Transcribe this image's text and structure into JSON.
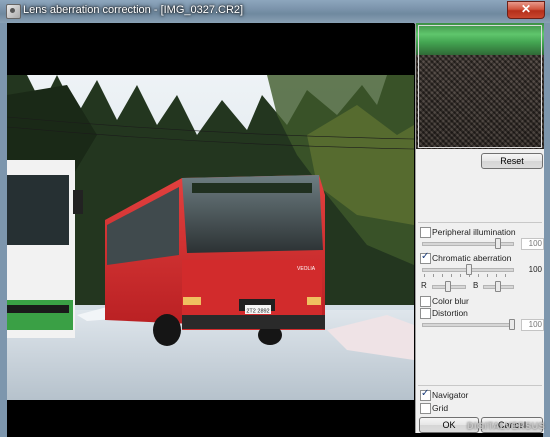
{
  "window": {
    "title": "Lens aberration correction - [IMG_0327.CR2]",
    "close_label": "✕"
  },
  "preview": {
    "bus_sign": "VEOLIA",
    "plate": "2T2 2892"
  },
  "panel": {
    "reset_label": "Reset",
    "peripheral": {
      "label": "Peripheral illumination",
      "checked": false,
      "value": "100",
      "level": 100
    },
    "chromatic": {
      "label": "Chromatic aberration",
      "checked": true,
      "value": "100",
      "level": 100,
      "r_label": "R",
      "b_label": "B"
    },
    "color_blur": {
      "label": "Color blur",
      "checked": false
    },
    "distortion": {
      "label": "Distortion",
      "checked": false,
      "value": "100",
      "level": 100
    },
    "navigator": {
      "label": "Navigator",
      "checked": true
    },
    "grid": {
      "label": "Grid",
      "checked": false
    },
    "ok_label": "OK",
    "cancel_label": "Cancel"
  },
  "watermark": "DIGITALVERSUS",
  "colors": {
    "titlebar": "#7a93aa",
    "panel": "#f0f0f0",
    "close": "#c9472f"
  }
}
